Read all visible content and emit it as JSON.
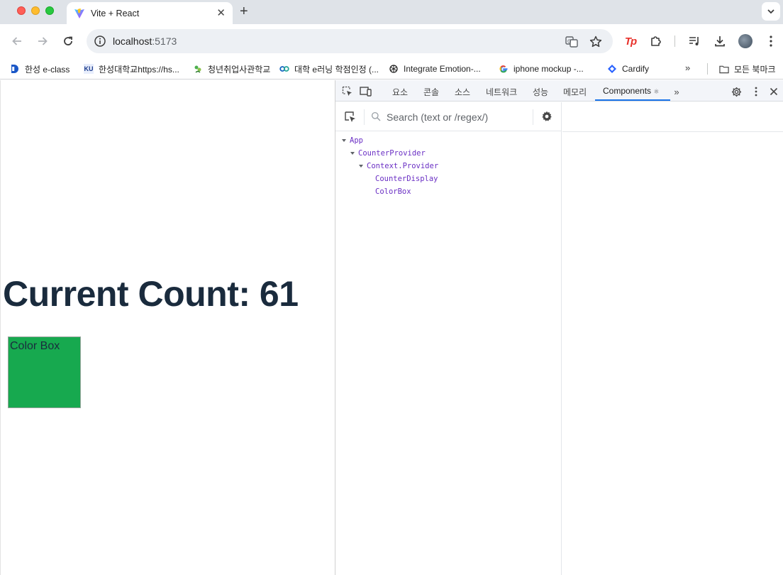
{
  "browser": {
    "tab": {
      "title": "Vite + React"
    },
    "address": {
      "host": "localhost",
      "port": ":5173"
    },
    "bookmarks": [
      {
        "label": "한성 e-class",
        "icon": "hansung-eclass-icon"
      },
      {
        "label": "한성대학교https://hs...",
        "icon": "hansung-univ-icon"
      },
      {
        "label": "청년취업사관학교",
        "icon": "youth-academy-icon"
      },
      {
        "label": "대학 e러닝 학점인정 (...",
        "icon": "elearning-icon"
      },
      {
        "label": "Integrate Emotion-...",
        "icon": "openai-icon"
      },
      {
        "label": "iphone mockup -...",
        "icon": "google-icon"
      },
      {
        "label": "Cardify",
        "icon": "cardify-icon"
      }
    ],
    "all_bookmarks": "모든 북마크"
  },
  "page": {
    "heading": "Current Count: 61",
    "color_box": {
      "label": "Color Box",
      "color": "#17a94f"
    }
  },
  "devtools": {
    "tabs": [
      "요소",
      "콘솔",
      "소스",
      "네트워크",
      "성능",
      "메모리",
      "Components"
    ],
    "active_tab": "Components",
    "search_placeholder": "Search (text or /regex/)",
    "tree": [
      {
        "name": "App",
        "depth": 0,
        "expanded": true
      },
      {
        "name": "CounterProvider",
        "depth": 1,
        "expanded": true
      },
      {
        "name": "Context.Provider",
        "depth": 2,
        "expanded": true
      },
      {
        "name": "CounterDisplay",
        "depth": 3,
        "expanded": false
      },
      {
        "name": "ColorBox",
        "depth": 3,
        "expanded": false
      }
    ]
  }
}
